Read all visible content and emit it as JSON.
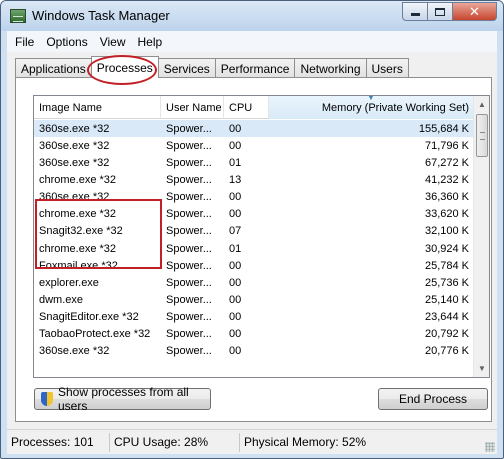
{
  "window": {
    "title": "Windows Task Manager",
    "close_label": "✕"
  },
  "menu": [
    "File",
    "Options",
    "View",
    "Help"
  ],
  "tabs": [
    {
      "label": "Applications",
      "active": false
    },
    {
      "label": "Processes",
      "active": true
    },
    {
      "label": "Services",
      "active": false
    },
    {
      "label": "Performance",
      "active": false
    },
    {
      "label": "Networking",
      "active": false
    },
    {
      "label": "Users",
      "active": false
    }
  ],
  "table": {
    "columns": [
      "Image Name",
      "User Name",
      "CPU",
      "Memory (Private Working Set)"
    ],
    "sorted_column": 3,
    "selected_row": 0,
    "rows": [
      [
        "360se.exe *32",
        "Spower...",
        "00",
        "155,684 K"
      ],
      [
        "360se.exe *32",
        "Spower...",
        "00",
        "71,796 K"
      ],
      [
        "360se.exe *32",
        "Spower...",
        "01",
        "67,272 K"
      ],
      [
        "chrome.exe *32",
        "Spower...",
        "13",
        "41,232 K"
      ],
      [
        "360se.exe *32",
        "Spower...",
        "00",
        "36,360 K"
      ],
      [
        "chrome.exe *32",
        "Spower...",
        "00",
        "33,620 K"
      ],
      [
        "Snagit32.exe *32",
        "Spower...",
        "07",
        "32,100 K"
      ],
      [
        "chrome.exe *32",
        "Spower...",
        "01",
        "30,924 K"
      ],
      [
        "Foxmail.exe *32",
        "Spower...",
        "00",
        "25,784 K"
      ],
      [
        "explorer.exe",
        "Spower...",
        "00",
        "25,736 K"
      ],
      [
        "dwm.exe",
        "Spower...",
        "00",
        "25,140 K"
      ],
      [
        "SnagitEditor.exe *32",
        "Spower...",
        "00",
        "23,644 K"
      ],
      [
        "TaobaoProtect.exe *32",
        "Spower...",
        "00",
        "20,792 K"
      ],
      [
        "360se.exe *32",
        "Spower...",
        "00",
        "20,776 K"
      ],
      [
        "",
        "",
        "",
        ""
      ]
    ]
  },
  "buttons": {
    "show_all": "Show processes from all users",
    "end_process": "End Process"
  },
  "status": {
    "processes": "Processes: 101",
    "cpu": "CPU Usage: 28%",
    "memory": "Physical Memory: 52%"
  },
  "colors": {
    "annotation": "#c31f26",
    "selection": "#d9e9f8"
  }
}
